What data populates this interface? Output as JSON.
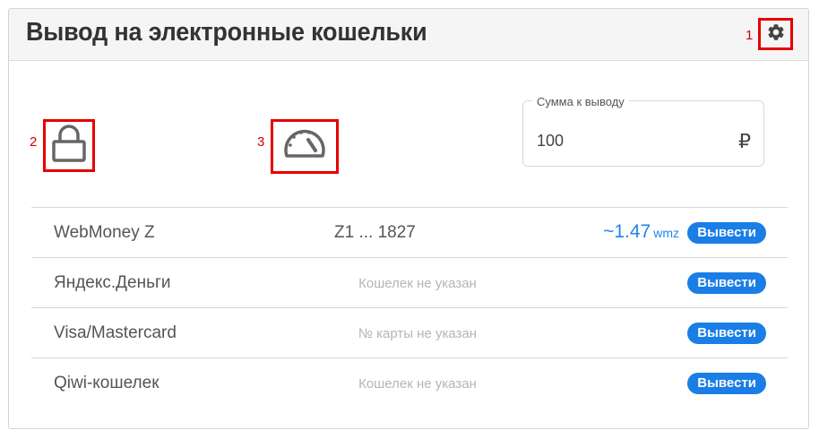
{
  "header": {
    "title": "Вывод на электронные кошельки"
  },
  "annotations": {
    "settings": "1",
    "lock": "2",
    "speed": "3"
  },
  "icons": {
    "settings": "gear-icon",
    "lock": "lock-icon",
    "speed": "speedometer-icon"
  },
  "amount": {
    "label": "Сумма к выводу",
    "value": "100",
    "currency": "₽"
  },
  "withdraw_label": "Вывести",
  "rows": [
    {
      "name": "WebMoney Z",
      "wallet": "Z1 ... 1827",
      "estimate": "~1.47",
      "unit": "wmz"
    },
    {
      "name": "Яндекс.Деньги",
      "placeholder": "Кошелек не указан"
    },
    {
      "name": "Visa/Mastercard",
      "placeholder": "№ карты не указан"
    },
    {
      "name": "Qiwi-кошелек",
      "placeholder": "Кошелек не указан"
    }
  ],
  "colors": {
    "accent": "#1a7ee6",
    "annotation": "#e60000",
    "estimate": "#2283e8"
  }
}
